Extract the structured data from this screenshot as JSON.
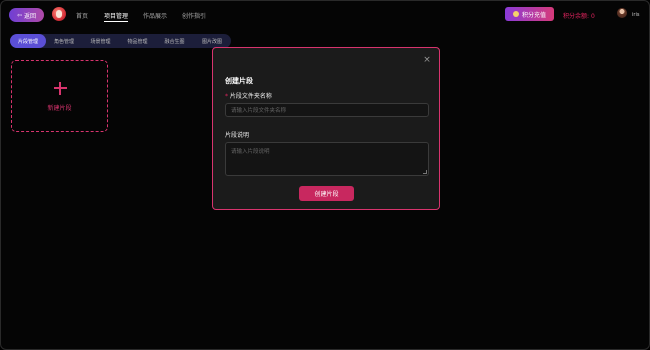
{
  "topbar": {
    "back_label": "返回",
    "nav": [
      "首页",
      "项目管理",
      "作品展示",
      "创作指引"
    ],
    "recharge_label": "积分充值",
    "balance_label": "积分余额:",
    "balance_value": "0",
    "username": "iris"
  },
  "tabs": [
    "片段管理",
    "角色管理",
    "场景管理",
    "物品管理",
    "融合生图",
    "图片改图"
  ],
  "card": {
    "label": "新建片段"
  },
  "modal": {
    "title": "创建片段",
    "required_mark": "*",
    "folder_label": "片段文件夹名称",
    "folder_placeholder": "请输入片段文件夹名称",
    "desc_label": "片段说明",
    "desc_placeholder": "请输入片段说明",
    "submit_label": "创建片段",
    "close_symbol": "×"
  },
  "icons": [
    "back-arrow-icon",
    "logo-icon",
    "coin-icon",
    "avatar",
    "close-icon",
    "plus-icon"
  ],
  "colors": {
    "accent": "#d8346e",
    "tab_active": "#5b4fd6",
    "button": "#c8285f"
  }
}
